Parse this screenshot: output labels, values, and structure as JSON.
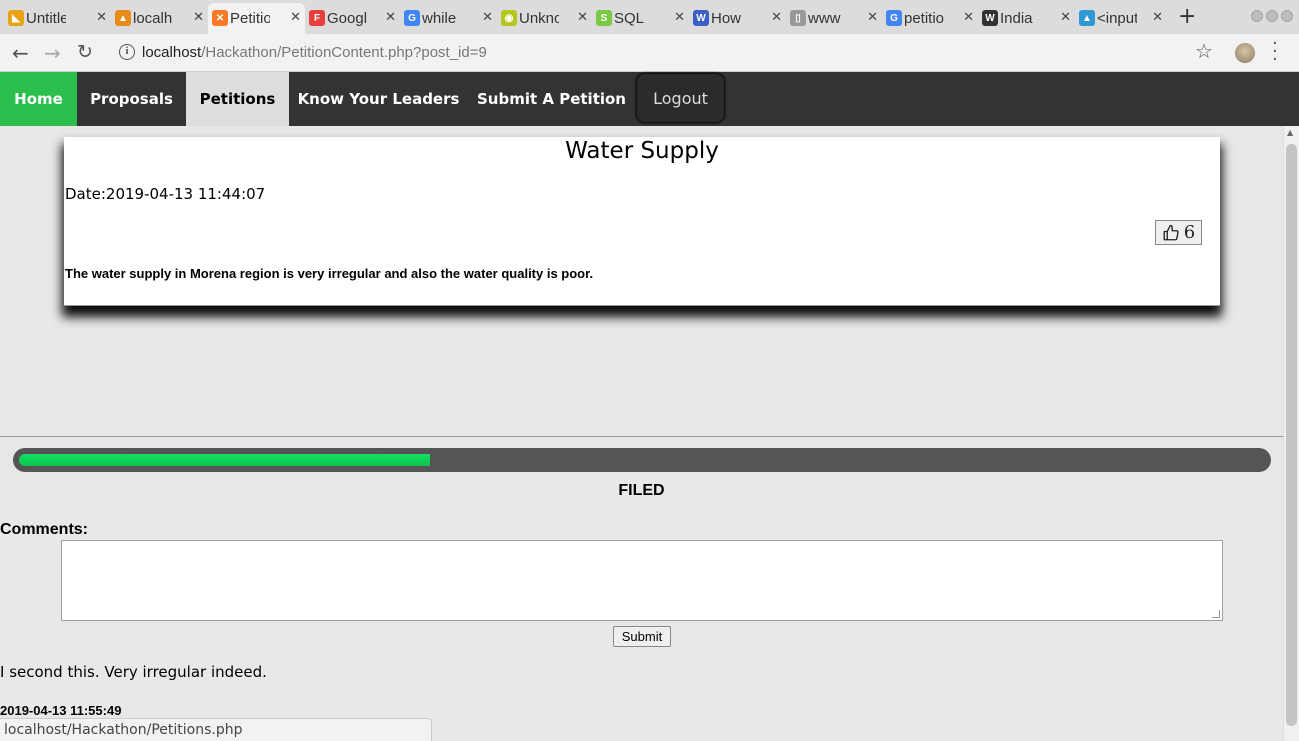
{
  "browser": {
    "tabs": [
      {
        "title": "Untitled",
        "icon": "shapes-icon",
        "color": "#e8a317"
      },
      {
        "title": "localhost",
        "icon": "phpmyadmin-icon",
        "color": "#e88a17"
      },
      {
        "title": "Petitions",
        "icon": "xampp-icon",
        "color": "#fb7a24",
        "active": true
      },
      {
        "title": "Google Fonts",
        "icon": "google-fonts-icon",
        "color": "#ea3d3d"
      },
      {
        "title": "while",
        "icon": "google-icon",
        "color": "#4285f4"
      },
      {
        "title": "Unknown",
        "icon": "eye-icon",
        "color": "#b5c81a"
      },
      {
        "title": "SQL",
        "icon": "sql-icon",
        "color": "#7ac943"
      },
      {
        "title": "How",
        "icon": "wikihow-icon",
        "color": "#3b5fc4"
      },
      {
        "title": "www",
        "icon": "page-icon",
        "color": "#999999"
      },
      {
        "title": "petition",
        "icon": "google-icon",
        "color": "#4285f4"
      },
      {
        "title": "India",
        "icon": "wikipedia-icon",
        "color": "#333333"
      },
      {
        "title": "<input",
        "icon": "w3-icon",
        "color": "#2d9ad6"
      }
    ],
    "url_host": "localhost",
    "url_path": "/Hackathon/PetitionContent.php?post_id=9",
    "status_url": "localhost/Hackathon/Petitions.php"
  },
  "nav": {
    "home": "Home",
    "proposals": "Proposals",
    "petitions": "Petitions",
    "leaders": "Know Your Leaders",
    "submit": "Submit A Petition",
    "logout": "Logout"
  },
  "petition": {
    "title": "Water Supply",
    "date": "Date:2019-04-13 11:44:07",
    "likes": "6",
    "body": "The water supply in Morena region is very irregular and also the water quality is poor."
  },
  "progress": {
    "fraction": 0.33,
    "status": "FILED",
    "colors": {
      "fill": "#0cc44c",
      "track": "#555555"
    }
  },
  "comments": {
    "label": "Comments:",
    "submit": "Submit",
    "items": [
      {
        "text": "I second this. Very irregular indeed.",
        "date": "2019-04-13 11:55:49"
      }
    ]
  },
  "colors": {
    "home_green": "#2dbf4e",
    "navbar": "#333333"
  }
}
